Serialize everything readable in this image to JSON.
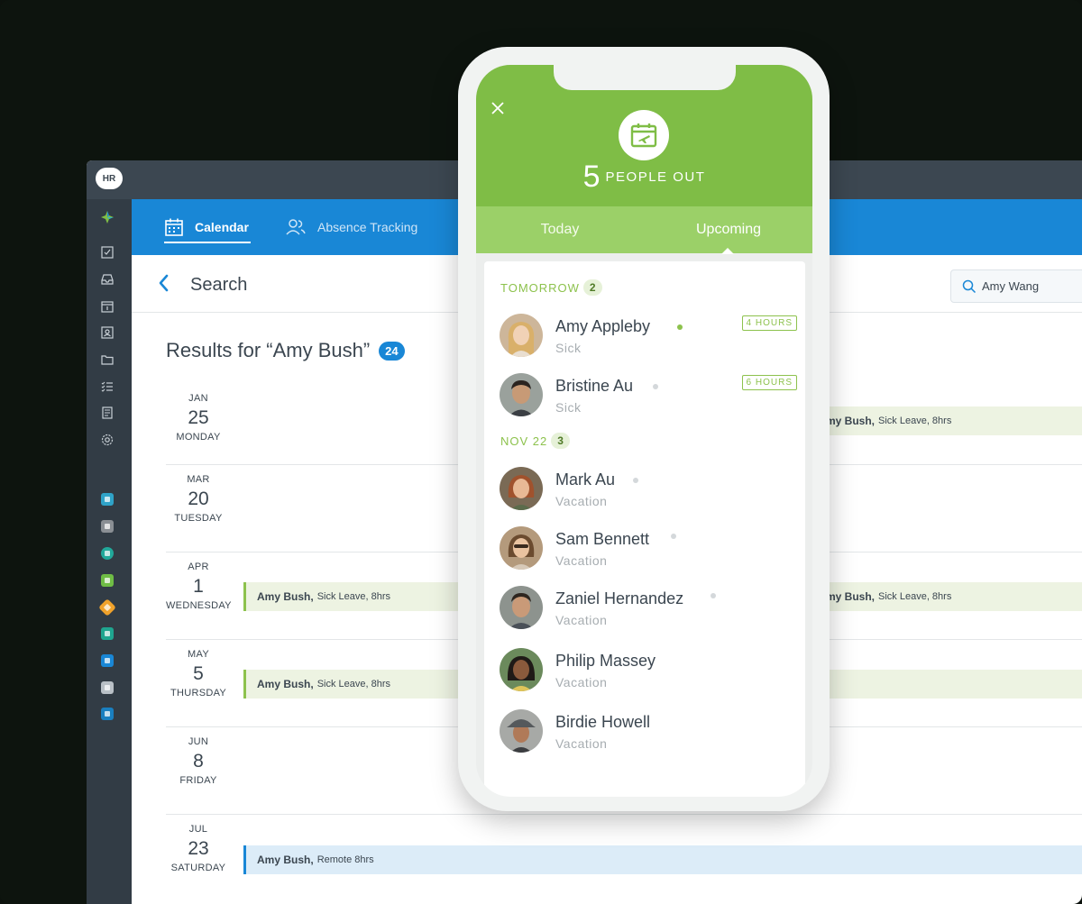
{
  "desktop": {
    "logo": "HR",
    "nav": {
      "calendar_label": "Calendar",
      "absence_label": "Absence Tracking"
    },
    "page_title": "Search",
    "search_value": "Amy Wang",
    "results_title": "Results for “Amy Bush”",
    "results_count": "24",
    "dates": [
      {
        "month": "JAN",
        "day": "25",
        "weekday": "MONDAY"
      },
      {
        "month": "MAR",
        "day": "20",
        "weekday": "TUESDAY"
      },
      {
        "month": "APR",
        "day": "1",
        "weekday": "WEDNESDAY"
      },
      {
        "month": "MAY",
        "day": "5",
        "weekday": "THURSDAY"
      },
      {
        "month": "JUN",
        "day": "8",
        "weekday": "FRIDAY"
      },
      {
        "month": "JUL",
        "day": "23",
        "weekday": "SATURDAY"
      }
    ],
    "events": {
      "jan_right": {
        "name": "my Bush,",
        "detail": "Sick Leave, 8hrs"
      },
      "apr_left": {
        "name": "Amy Bush,",
        "detail": "Sick Leave, 8hrs"
      },
      "apr_right": {
        "name": "my Bush,",
        "detail": "Sick Leave, 8hrs"
      },
      "may_left": {
        "name": "Amy Bush,",
        "detail": "Sick Leave, 8hrs"
      },
      "jul": {
        "name": "Amy Bush,",
        "detail": "Remote 8hrs"
      }
    }
  },
  "phone": {
    "people_count": "5",
    "people_label": "PEOPLE OUT",
    "tabs": {
      "today": "Today",
      "upcoming": "Upcoming"
    },
    "sections": [
      {
        "label": "TOMORROW",
        "count": "2",
        "people": [
          {
            "name": "Amy Appleby",
            "reason": "Sick",
            "hours": "4 HOURS",
            "online": true
          },
          {
            "name": "Bristine Au",
            "reason": "Sick",
            "hours": "6 HOURS",
            "online": false
          }
        ]
      },
      {
        "label": "NOV 22",
        "count": "3",
        "people": [
          {
            "name": "Mark Au",
            "reason": "Vacation",
            "online": false
          },
          {
            "name": "Sam Bennett",
            "reason": "Vacation",
            "online": false
          },
          {
            "name": "Zaniel Hernandez",
            "reason": "Vacation",
            "online": false
          },
          {
            "name": "Philip Massey",
            "reason": "Vacation",
            "online": false
          },
          {
            "name": "Birdie Howell",
            "reason": "Vacation",
            "online": false
          }
        ]
      }
    ]
  },
  "colors": {
    "brand_blue": "#1987d6",
    "brand_green": "#7fbd46",
    "accent_green": "#8dc24d",
    "sidebar": "#323c45"
  }
}
